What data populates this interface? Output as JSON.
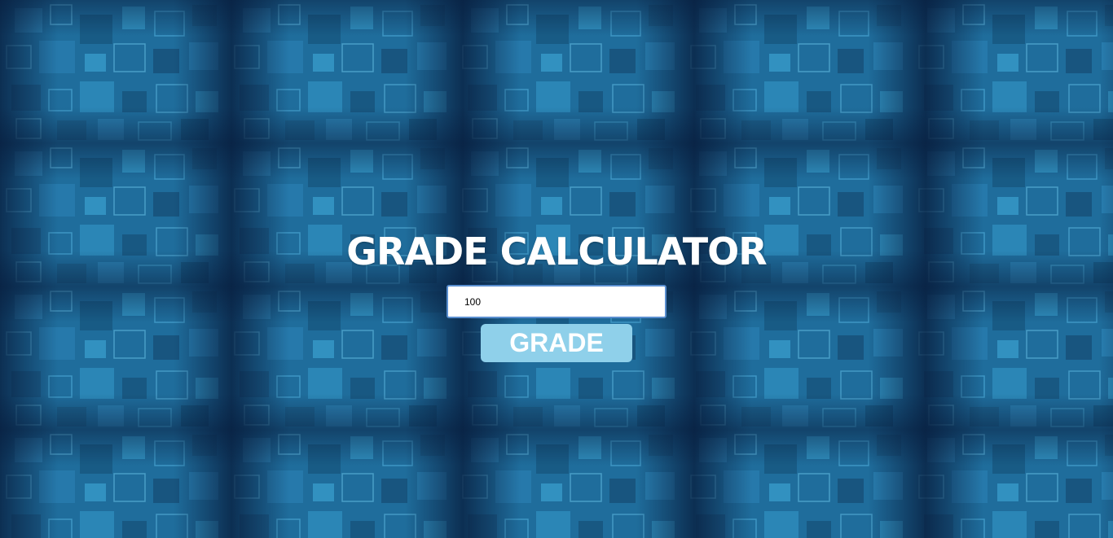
{
  "page": {
    "title": "GRADE CALCULATOR"
  },
  "form": {
    "score_value": "100",
    "submit_label": "GRADE"
  },
  "colors": {
    "background": "#1e5f8c",
    "background_dark": "#061a3a",
    "tile_light": "#3a9ccd",
    "title_text": "#ffffff",
    "button_bg": "#8fd0ea",
    "button_text": "#ffffff",
    "input_border": "#5a8fd0"
  }
}
